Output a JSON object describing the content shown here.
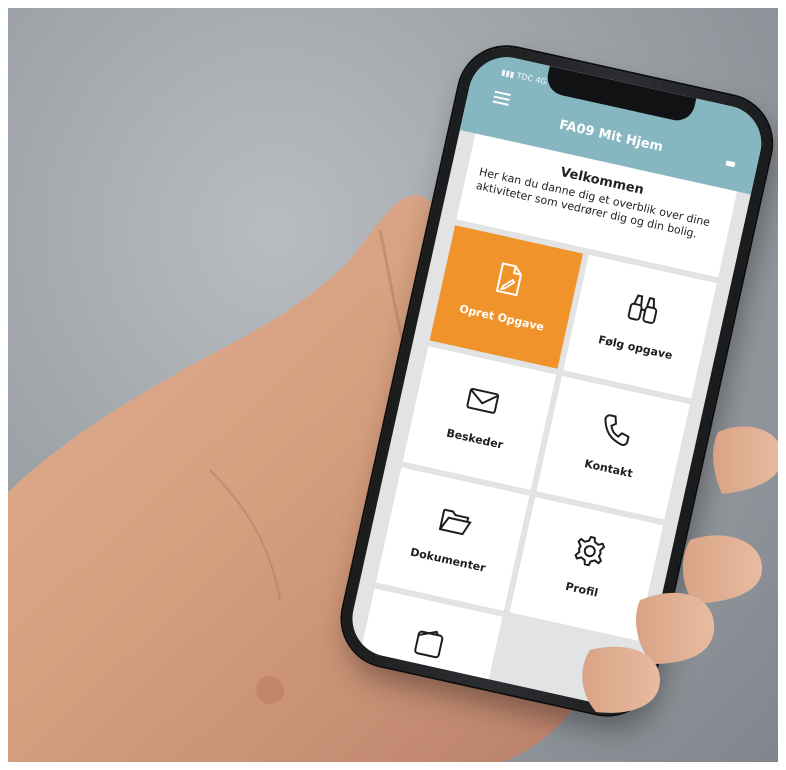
{
  "app": {
    "carrier": "TDC",
    "network": "4G",
    "title": "FA09 Mit Hjem",
    "colors": {
      "header": "#86b7c1",
      "accent": "#f0932b",
      "tile": "#ffffff",
      "background": "#e2e3e4"
    }
  },
  "welcome": {
    "title": "Velkommen",
    "text": "Her kan du danne dig et overblik over dine aktiviteter som vedrører dig og din bolig."
  },
  "tiles": [
    {
      "label": "Opret Opgave",
      "icon": "edit-document-icon",
      "active": true
    },
    {
      "label": "Følg opgave",
      "icon": "binoculars-icon",
      "active": false
    },
    {
      "label": "Beskeder",
      "icon": "envelope-icon",
      "active": false
    },
    {
      "label": "Kontakt",
      "icon": "phone-icon",
      "active": false
    },
    {
      "label": "Dokumenter",
      "icon": "folder-icon",
      "active": false
    },
    {
      "label": "Profil",
      "icon": "gear-icon",
      "active": false
    },
    {
      "label": "",
      "icon": "wallet-icon",
      "active": false
    }
  ]
}
